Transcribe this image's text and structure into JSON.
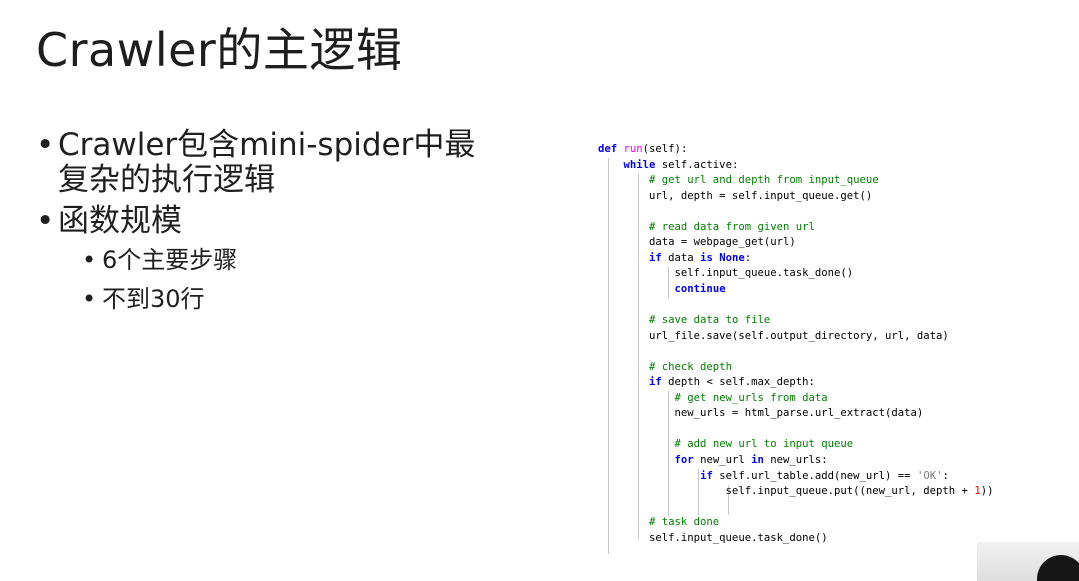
{
  "slide": {
    "title": "Crawler的主逻辑",
    "bullets": [
      {
        "lines": [
          "Crawler包含mini-spider中最",
          "复杂的执行逻辑"
        ]
      },
      {
        "lines": [
          "函数规模"
        ]
      }
    ],
    "sub_bullets": [
      "6个主要步骤",
      "不到30行"
    ],
    "bullet_glyph": "•"
  },
  "code": {
    "language": "python",
    "lines": [
      "def run(self):",
      "    while self.active:",
      "        # get url and depth from input_queue",
      "        url, depth = self.input_queue.get()",
      "",
      "        # read data from given url",
      "        data = webpage_get(url)",
      "        if data is None:",
      "            self.input_queue.task_done()",
      "            continue",
      "",
      "        # save data to file",
      "        url_file.save(self.output_directory, url, data)",
      "",
      "        # check depth",
      "        if depth < self.max_depth:",
      "            # get new_urls from data",
      "            new_urls = html_parse.url_extract(data)",
      "",
      "            # add new url to input queue",
      "            for new_url in new_urls:",
      "                if self.url_table.add(new_url) == 'OK':",
      "                    self.input_queue.put((new_url, depth + 1))",
      "",
      "        # task done",
      "        self.input_queue.task_done()"
    ]
  },
  "colors": {
    "keyword": "#0000ff",
    "function_name": "#ff00ff",
    "comment": "#008000",
    "string": "#808080",
    "number": "#ff0000"
  },
  "webcam": {
    "icon": "webcam-thumbnail"
  }
}
